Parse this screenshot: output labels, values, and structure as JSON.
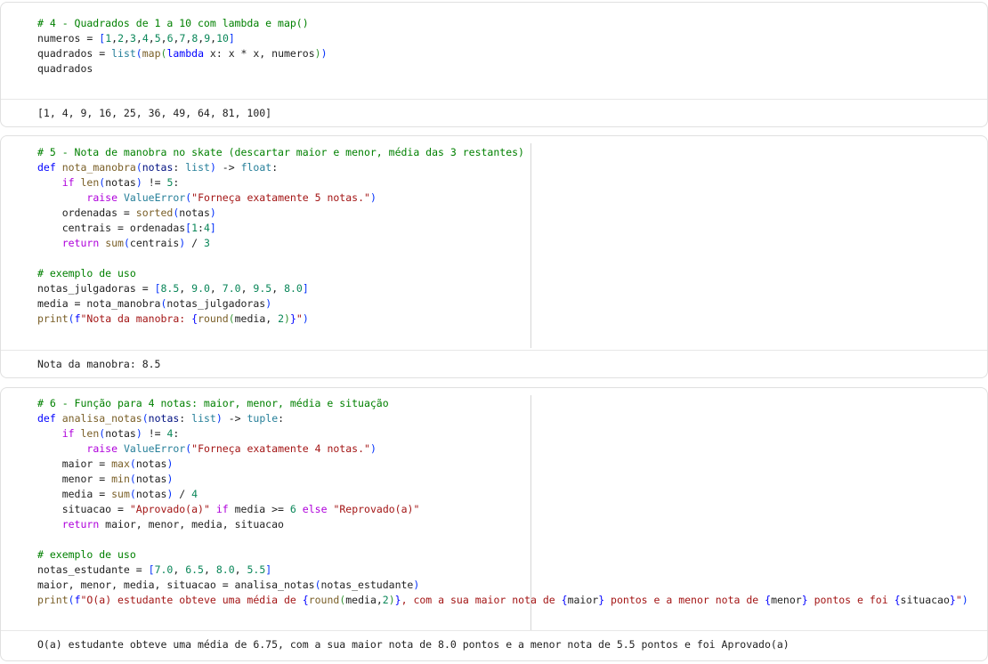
{
  "cells": [
    {
      "lines": [
        [
          [
            "c",
            "# 4 - Quadrados de 1 a 10 com lambda e map()"
          ]
        ],
        [
          [
            "",
            "numeros = "
          ],
          [
            "b",
            "["
          ],
          [
            "n",
            "1"
          ],
          [
            "",
            ","
          ],
          [
            "n",
            "2"
          ],
          [
            "",
            ","
          ],
          [
            "n",
            "3"
          ],
          [
            "",
            ","
          ],
          [
            "n",
            "4"
          ],
          [
            "",
            ","
          ],
          [
            "n",
            "5"
          ],
          [
            "",
            ","
          ],
          [
            "n",
            "6"
          ],
          [
            "",
            ","
          ],
          [
            "n",
            "7"
          ],
          [
            "",
            ","
          ],
          [
            "n",
            "8"
          ],
          [
            "",
            ","
          ],
          [
            "n",
            "9"
          ],
          [
            "",
            ","
          ],
          [
            "n",
            "10"
          ],
          [
            "b",
            "]"
          ]
        ],
        [
          [
            "",
            "quadrados = "
          ],
          [
            "t",
            "list"
          ],
          [
            "b",
            "("
          ],
          [
            "f",
            "map"
          ],
          [
            "g",
            "("
          ],
          [
            "k",
            "lambda"
          ],
          [
            "",
            " x: x * x, numeros"
          ],
          [
            "g",
            ")"
          ],
          [
            "b",
            ")"
          ]
        ],
        [
          [
            "",
            "quadrados"
          ]
        ]
      ],
      "output": "[1, 4, 9, 16, 25, 36, 49, 64, 81, 100]"
    },
    {
      "lines": [
        [
          [
            "c",
            "# 5 - Nota de manobra no skate (descartar maior e menor, média das 3 restantes)"
          ]
        ],
        [
          [
            "k",
            "def"
          ],
          [
            "",
            " "
          ],
          [
            "f",
            "nota_manobra"
          ],
          [
            "b",
            "("
          ],
          [
            "p",
            "notas"
          ],
          [
            "",
            ": "
          ],
          [
            "t",
            "list"
          ],
          [
            "b",
            ")"
          ],
          [
            "",
            " -> "
          ],
          [
            "t",
            "float"
          ],
          [
            "",
            ":"
          ]
        ],
        [
          [
            "",
            "    "
          ],
          [
            "m",
            "if"
          ],
          [
            "",
            " "
          ],
          [
            "f",
            "len"
          ],
          [
            "b",
            "("
          ],
          [
            "",
            "notas"
          ],
          [
            "b",
            ")"
          ],
          [
            "",
            " != "
          ],
          [
            "n",
            "5"
          ],
          [
            "",
            ":"
          ]
        ],
        [
          [
            "",
            "        "
          ],
          [
            "m",
            "raise"
          ],
          [
            "",
            " "
          ],
          [
            "t",
            "ValueError"
          ],
          [
            "b",
            "("
          ],
          [
            "s",
            "\"Forneça exatamente 5 notas.\""
          ],
          [
            "b",
            ")"
          ]
        ],
        [
          [
            "",
            "    ordenadas = "
          ],
          [
            "f",
            "sorted"
          ],
          [
            "b",
            "("
          ],
          [
            "",
            "notas"
          ],
          [
            "b",
            ")"
          ]
        ],
        [
          [
            "",
            "    centrais = ordenadas"
          ],
          [
            "b",
            "["
          ],
          [
            "n",
            "1"
          ],
          [
            "",
            ":"
          ],
          [
            "n",
            "4"
          ],
          [
            "b",
            "]"
          ]
        ],
        [
          [
            "",
            "    "
          ],
          [
            "m",
            "return"
          ],
          [
            "",
            " "
          ],
          [
            "f",
            "sum"
          ],
          [
            "b",
            "("
          ],
          [
            "",
            "centrais"
          ],
          [
            "b",
            ")"
          ],
          [
            "",
            " / "
          ],
          [
            "n",
            "3"
          ]
        ],
        [
          [
            "",
            ""
          ]
        ],
        [
          [
            "c",
            "# exemplo de uso"
          ]
        ],
        [
          [
            "",
            "notas_julgadoras = "
          ],
          [
            "b",
            "["
          ],
          [
            "n",
            "8.5"
          ],
          [
            "",
            ", "
          ],
          [
            "n",
            "9.0"
          ],
          [
            "",
            ", "
          ],
          [
            "n",
            "7.0"
          ],
          [
            "",
            ", "
          ],
          [
            "n",
            "9.5"
          ],
          [
            "",
            ", "
          ],
          [
            "n",
            "8.0"
          ],
          [
            "b",
            "]"
          ]
        ],
        [
          [
            "",
            "media = nota_manobra"
          ],
          [
            "b",
            "("
          ],
          [
            "",
            "notas_julgadoras"
          ],
          [
            "b",
            ")"
          ]
        ],
        [
          [
            "f",
            "print"
          ],
          [
            "b",
            "("
          ],
          [
            "k",
            "f"
          ],
          [
            "s",
            "\"Nota da manobra: "
          ],
          [
            "k",
            "{"
          ],
          [
            "f",
            "round"
          ],
          [
            "g",
            "("
          ],
          [
            "",
            "media, "
          ],
          [
            "n",
            "2"
          ],
          [
            "g",
            ")"
          ],
          [
            "k",
            "}"
          ],
          [
            "s",
            "\""
          ],
          [
            "b",
            ")"
          ]
        ]
      ],
      "output": "Nota da manobra: 8.5"
    },
    {
      "lines": [
        [
          [
            "c",
            "# 6 - Função para 4 notas: maior, menor, média e situação"
          ]
        ],
        [
          [
            "k",
            "def"
          ],
          [
            "",
            " "
          ],
          [
            "f",
            "analisa_notas"
          ],
          [
            "b",
            "("
          ],
          [
            "p",
            "notas"
          ],
          [
            "",
            ": "
          ],
          [
            "t",
            "list"
          ],
          [
            "b",
            ")"
          ],
          [
            "",
            " -> "
          ],
          [
            "t",
            "tuple"
          ],
          [
            "",
            ":"
          ]
        ],
        [
          [
            "",
            "    "
          ],
          [
            "m",
            "if"
          ],
          [
            "",
            " "
          ],
          [
            "f",
            "len"
          ],
          [
            "b",
            "("
          ],
          [
            "",
            "notas"
          ],
          [
            "b",
            ")"
          ],
          [
            "",
            " != "
          ],
          [
            "n",
            "4"
          ],
          [
            "",
            ":"
          ]
        ],
        [
          [
            "",
            "        "
          ],
          [
            "m",
            "raise"
          ],
          [
            "",
            " "
          ],
          [
            "t",
            "ValueError"
          ],
          [
            "b",
            "("
          ],
          [
            "s",
            "\"Forneça exatamente 4 notas.\""
          ],
          [
            "b",
            ")"
          ]
        ],
        [
          [
            "",
            "    maior = "
          ],
          [
            "f",
            "max"
          ],
          [
            "b",
            "("
          ],
          [
            "",
            "notas"
          ],
          [
            "b",
            ")"
          ]
        ],
        [
          [
            "",
            "    menor = "
          ],
          [
            "f",
            "min"
          ],
          [
            "b",
            "("
          ],
          [
            "",
            "notas"
          ],
          [
            "b",
            ")"
          ]
        ],
        [
          [
            "",
            "    media = "
          ],
          [
            "f",
            "sum"
          ],
          [
            "b",
            "("
          ],
          [
            "",
            "notas"
          ],
          [
            "b",
            ")"
          ],
          [
            "",
            " / "
          ],
          [
            "n",
            "4"
          ]
        ],
        [
          [
            "",
            "    situacao = "
          ],
          [
            "s",
            "\"Aprovado(a)\""
          ],
          [
            "",
            " "
          ],
          [
            "m",
            "if"
          ],
          [
            "",
            " media >= "
          ],
          [
            "n",
            "6"
          ],
          [
            "",
            " "
          ],
          [
            "m",
            "else"
          ],
          [
            "",
            " "
          ],
          [
            "s",
            "\"Reprovado(a)\""
          ]
        ],
        [
          [
            "",
            "    "
          ],
          [
            "m",
            "return"
          ],
          [
            "",
            " maior, menor, media, situacao"
          ]
        ],
        [
          [
            "",
            ""
          ]
        ],
        [
          [
            "c",
            "# exemplo de uso"
          ]
        ],
        [
          [
            "",
            "notas_estudante = "
          ],
          [
            "b",
            "["
          ],
          [
            "n",
            "7.0"
          ],
          [
            "",
            ", "
          ],
          [
            "n",
            "6.5"
          ],
          [
            "",
            ", "
          ],
          [
            "n",
            "8.0"
          ],
          [
            "",
            ", "
          ],
          [
            "n",
            "5.5"
          ],
          [
            "b",
            "]"
          ]
        ],
        [
          [
            "",
            "maior, menor, media, situacao = analisa_notas"
          ],
          [
            "b",
            "("
          ],
          [
            "",
            "notas_estudante"
          ],
          [
            "b",
            ")"
          ]
        ],
        [
          [
            "f",
            "print"
          ],
          [
            "b",
            "("
          ],
          [
            "k",
            "f"
          ],
          [
            "s",
            "\"O(a) estudante obteve uma média de "
          ],
          [
            "k",
            "{"
          ],
          [
            "f",
            "round"
          ],
          [
            "g",
            "("
          ],
          [
            "",
            "media,"
          ],
          [
            "n",
            "2"
          ],
          [
            "g",
            ")"
          ],
          [
            "k",
            "}"
          ],
          [
            "s",
            ", com a sua maior nota de "
          ],
          [
            "k",
            "{"
          ],
          [
            "",
            "maior"
          ],
          [
            "k",
            "}"
          ],
          [
            "s",
            " pontos e a menor nota de "
          ],
          [
            "k",
            "{"
          ],
          [
            "",
            "menor"
          ],
          [
            "k",
            "}"
          ],
          [
            "s",
            " pontos e foi "
          ],
          [
            "k",
            "{"
          ],
          [
            "",
            "situacao"
          ],
          [
            "k",
            "}"
          ],
          [
            "s",
            "\""
          ],
          [
            "b",
            ")"
          ]
        ]
      ],
      "output": "O(a) estudante obteve uma média de 6.75, com a sua maior nota de 8.0 pontos e a menor nota de 5.5 pontos e foi Aprovado(a)"
    }
  ]
}
